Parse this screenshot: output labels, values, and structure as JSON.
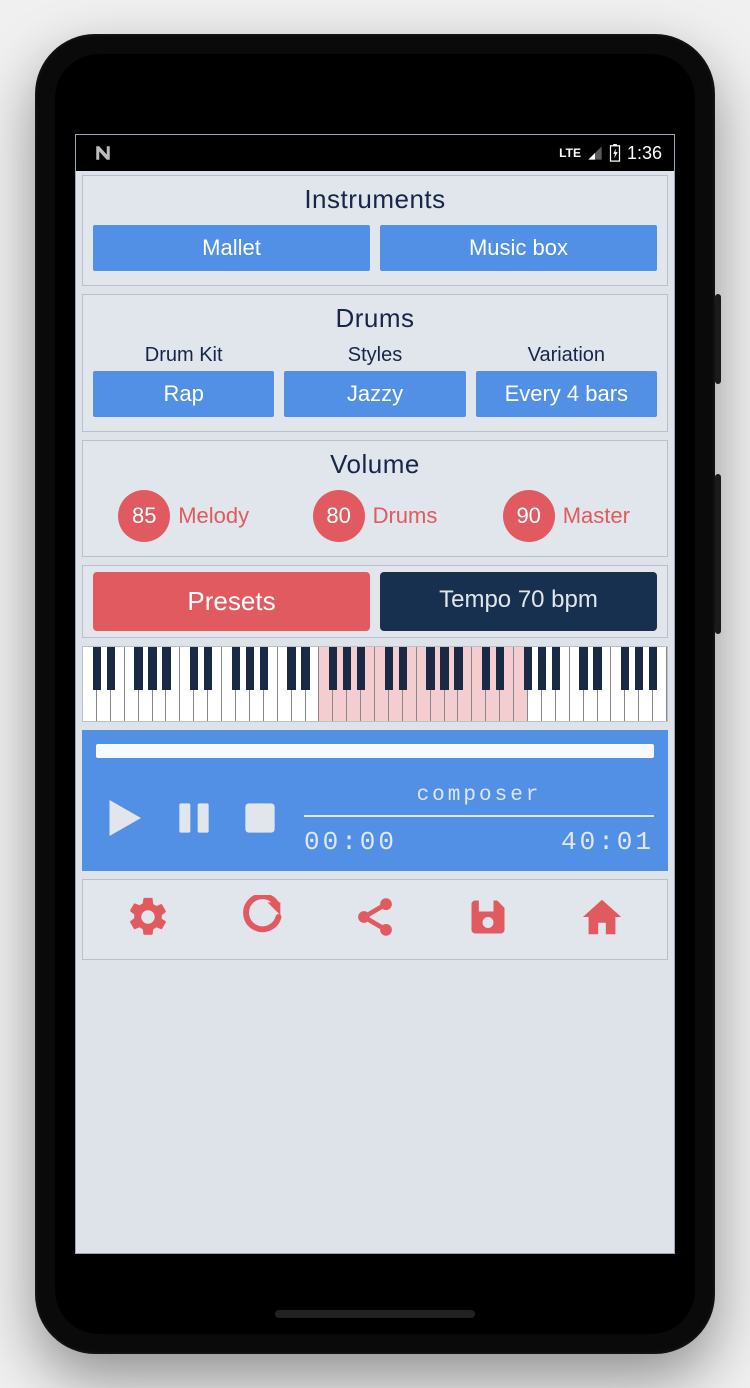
{
  "statusbar": {
    "time": "1:36",
    "network": "LTE"
  },
  "instruments": {
    "title": "Instruments",
    "left": "Mallet",
    "right": "Music box"
  },
  "drums": {
    "title": "Drums",
    "labels": {
      "kit": "Drum Kit",
      "styles": "Styles",
      "variation": "Variation"
    },
    "values": {
      "kit": "Rap",
      "styles": "Jazzy",
      "variation": "Every 4 bars"
    }
  },
  "volume": {
    "title": "Volume",
    "items": [
      {
        "value": "85",
        "label": "Melody"
      },
      {
        "value": "80",
        "label": "Drums"
      },
      {
        "value": "90",
        "label": "Master"
      }
    ]
  },
  "presets_label": "Presets",
  "tempo_label": "Tempo 70 bpm",
  "player": {
    "track": "composer",
    "elapsed": "00:00",
    "total": "40:01"
  },
  "colors": {
    "blue": "#5290e6",
    "red": "#e05a5f",
    "navy": "#18304f",
    "panel": "#e1e5ec"
  }
}
